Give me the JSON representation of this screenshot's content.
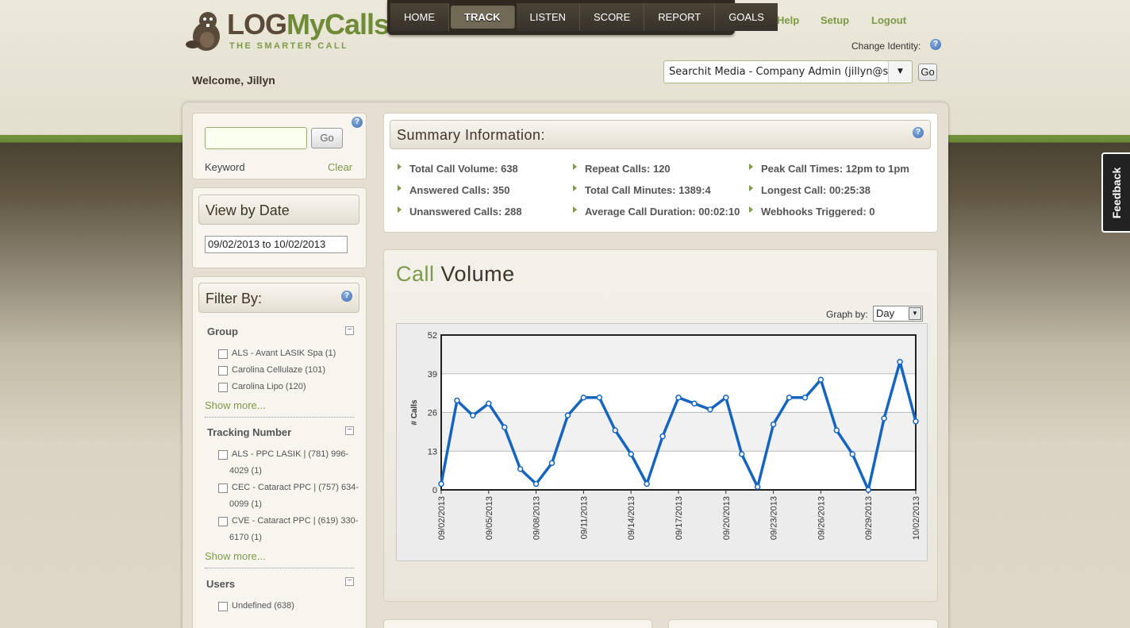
{
  "brand": {
    "logo_dark": "LOG",
    "logo_green": "MyCalls",
    "tagline": "THE SMARTER CALL"
  },
  "welcome": "Welcome, Jillyn",
  "nav": [
    {
      "label": "HOME",
      "active": false
    },
    {
      "label": "TRACK",
      "active": true
    },
    {
      "label": "LISTEN",
      "active": false
    },
    {
      "label": "SCORE",
      "active": false
    },
    {
      "label": "REPORT",
      "active": false
    },
    {
      "label": "GOALS",
      "active": false
    }
  ],
  "toplinks": {
    "help": "Help",
    "setup": "Setup",
    "logout": "Logout"
  },
  "identity": {
    "label": "Change Identity:",
    "value": "Searchit Media - Company Admin (jillyn@s",
    "go": "Go"
  },
  "search": {
    "value": "",
    "go": "Go",
    "keyword_label": "Keyword",
    "clear": "Clear"
  },
  "date": {
    "title": "View by Date",
    "range": "09/02/2013 to 10/02/2013"
  },
  "filter": {
    "title": "Filter By:",
    "group_title": "Group",
    "groups": [
      "ALS - Avant LASIK Spa (1)",
      "Carolina Cellulaze (101)",
      "Carolina Lipo (120)"
    ],
    "show_more": "Show more...",
    "tracking_title": "Tracking Number",
    "tracking": [
      {
        "line1": "ALS - PPC LASIK | (781) 996-",
        "line2": "4029 (1)"
      },
      {
        "line1": "CEC - Cataract PPC | (757) 634-",
        "line2": "0099 (1)"
      },
      {
        "line1": "CVE - Cataract PPC | (619) 330-",
        "line2": "6170 (1)"
      }
    ],
    "users_title": "Users",
    "users": [
      "Undefined (638)"
    ]
  },
  "summary": {
    "title": "Summary Information:",
    "items": [
      "Total Call Volume: 638",
      "Repeat Calls: 120",
      "Peak Call Times: 12pm to 1pm",
      "Answered Calls: 350",
      "Total Call Minutes: 1389:4",
      "Longest Call: 00:25:38",
      "Unanswered Calls: 288",
      "Average Call Duration: 00:02:10",
      "Webhooks Triggered: 0"
    ]
  },
  "volume": {
    "title_green": "Call",
    "title_dark": "Volume",
    "graph_by_label": "Graph by:",
    "graph_by_value": "Day"
  },
  "feedback": "Feedback",
  "colors": {
    "brand_green": "#7c9a47",
    "line": "#1565c0",
    "nav": "#2e2a22"
  },
  "chart_data": {
    "type": "line",
    "ylabel": "# Calls",
    "xlabel": "",
    "ylim": [
      0,
      52
    ],
    "yticks": [
      0,
      13,
      26,
      39,
      52
    ],
    "x": [
      "09/02/2013",
      "09/03/2013",
      "09/04/2013",
      "09/05/2013",
      "09/06/2013",
      "09/07/2013",
      "09/08/2013",
      "09/09/2013",
      "09/10/2013",
      "09/11/2013",
      "09/12/2013",
      "09/13/2013",
      "09/14/2013",
      "09/15/2013",
      "09/16/2013",
      "09/17/2013",
      "09/18/2013",
      "09/19/2013",
      "09/20/2013",
      "09/21/2013",
      "09/22/2013",
      "09/23/2013",
      "09/24/2013",
      "09/25/2013",
      "09/26/2013",
      "09/27/2013",
      "09/28/2013",
      "09/29/2013",
      "09/30/2013",
      "10/01/2013",
      "10/02/2013"
    ],
    "xticks": [
      "09/02/2013",
      "09/05/2013",
      "09/08/2013",
      "09/11/2013",
      "09/14/2013",
      "09/17/2013",
      "09/20/2013",
      "09/23/2013",
      "09/26/2013",
      "09/29/2013",
      "10/02/2013"
    ],
    "series": [
      {
        "values": [
          2,
          30,
          25,
          29,
          21,
          7,
          2,
          9,
          25,
          31,
          31,
          20,
          12,
          2,
          18,
          31,
          29,
          27,
          31,
          12,
          1,
          22,
          31,
          31,
          37,
          20,
          12,
          0,
          24,
          43,
          23
        ]
      }
    ],
    "grid": true
  }
}
